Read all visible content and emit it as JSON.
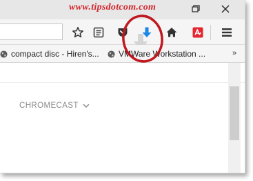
{
  "watermark": "www.tipsdotcom.com",
  "titlebar": {
    "restore_icon": "restore-icon",
    "close_icon": "close-icon"
  },
  "navbar": {
    "icons": [
      "star-icon",
      "reader-icon",
      "pocket-icon",
      "download-icon",
      "home-icon",
      "avira-icon",
      "menu-icon"
    ]
  },
  "bookmarks": {
    "items": [
      {
        "label": "compact disc - Hiren's...",
        "icon": "globe-icon"
      },
      {
        "label": "VMWare Workstation ...",
        "icon": "globe-icon"
      }
    ],
    "overflow": "»"
  },
  "content": {
    "chromecast_label": "CHROMECAST"
  },
  "colors": {
    "watermark": "#d2262c",
    "download_arrow": "#1a88e8",
    "pocket": "#333333",
    "avira": "#e3262f",
    "highlight_ring": "#c0181f"
  }
}
